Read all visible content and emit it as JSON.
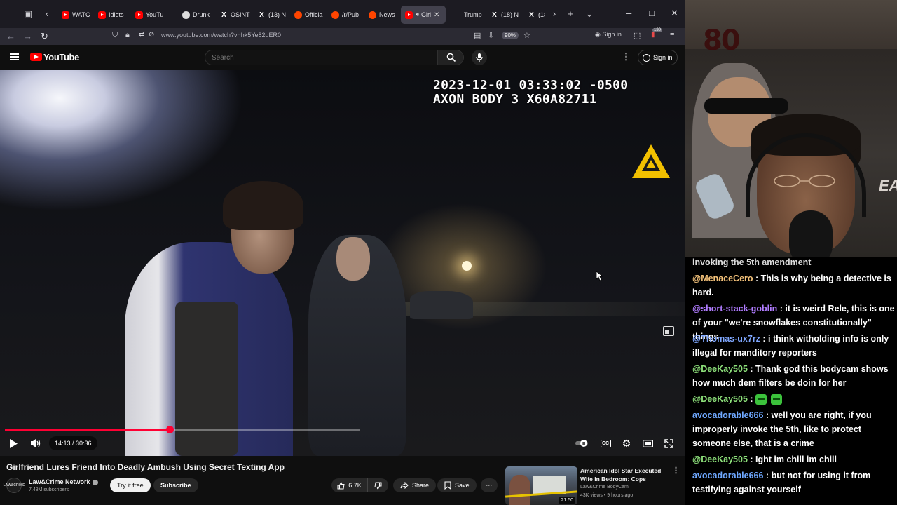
{
  "browser": {
    "tabs": [
      {
        "label": "WATC",
        "icon": "youtube-icon"
      },
      {
        "label": "Idiots",
        "icon": "youtube-icon"
      },
      {
        "label": "YouTu",
        "icon": "youtube-icon"
      },
      {
        "label": "Drunk",
        "icon": "github-icon"
      },
      {
        "label": "OSINT",
        "icon": "x-icon"
      },
      {
        "label": "(13) N",
        "icon": "x-icon"
      },
      {
        "label": "Officia",
        "icon": "reddit-icon"
      },
      {
        "label": "/r/Pub",
        "icon": "reddit-icon"
      },
      {
        "label": "News",
        "icon": "reddit-icon"
      },
      {
        "label": "Girl",
        "icon": "youtube-icon",
        "active": true
      },
      {
        "label": "Trump",
        "icon": "page-icon"
      },
      {
        "label": "(18) N",
        "icon": "x-icon"
      },
      {
        "label": "(18)",
        "icon": "x-icon"
      }
    ],
    "url": "www.youtube.com/watch?v=hk5Ye82qER0",
    "zoom": "90%",
    "sign_in": "Sign in",
    "notification_badge": "130"
  },
  "youtube": {
    "logo_text": "YouTube",
    "search_placeholder": "Search",
    "sign_in": "Sign in"
  },
  "player": {
    "timestamp_line1": "2023-12-01 03:33:02 -0500",
    "timestamp_line2": "AXON BODY 3 X60A82711",
    "time_display": "14:13 / 30:36",
    "progress_fraction": 0.4648,
    "accent_color": "#ff0033"
  },
  "video": {
    "title": "Girlfriend Lures Friend Into Deadly Ambush Using Secret Texting App",
    "channel": "Law&Crime Network",
    "channel_avatar_text": "LAW&CRIME",
    "subscribers": "7.48M subscribers",
    "try_free": "Try it free",
    "subscribe": "Subscribe",
    "likes": "6.7K",
    "share": "Share",
    "save": "Save"
  },
  "recommended": {
    "title": "American Idol Star Executed Wife in Bedroom: Cops",
    "channel": "Law&Crime BodyCam",
    "meta": "43K views • 9 hours ago",
    "duration": "21:50"
  },
  "stream": {
    "counter": "80",
    "partial_message": "invoking the 5th amendment",
    "chat": [
      {
        "user": "@MenaceCero",
        "color": "#f4c27a",
        "text": "This is why being a detective is hard."
      },
      {
        "user": "@short-stack-goblin",
        "color": "#b07cff",
        "text": "it is weird Rele, this is one of your \"we're snowflakes constitutionally\" things"
      },
      {
        "user": "@Thomas-ux7rz",
        "color": "#7fa7ff",
        "text": "i think witholding info is only illegal for manditory reporters"
      },
      {
        "user": "@DeeKay505",
        "color": "#8de07a",
        "text": "Thank god this bodycam shows how much dem filters be doin for her"
      },
      {
        "user": "@DeeKay505",
        "color": "#8de07a",
        "text": "",
        "emotes": 2
      },
      {
        "user": "avocadorable666",
        "color": "#6fa8ff",
        "text": "well you are right, if you improperly invoke the 5th, like to protect someone else, that is a crime"
      },
      {
        "user": "@DeeKay505",
        "color": "#8de07a",
        "text": "Ight im chill im chill"
      },
      {
        "user": "avocadorable666",
        "color": "#6fa8ff",
        "text": "but not for using it from testifying against yourself"
      }
    ]
  }
}
